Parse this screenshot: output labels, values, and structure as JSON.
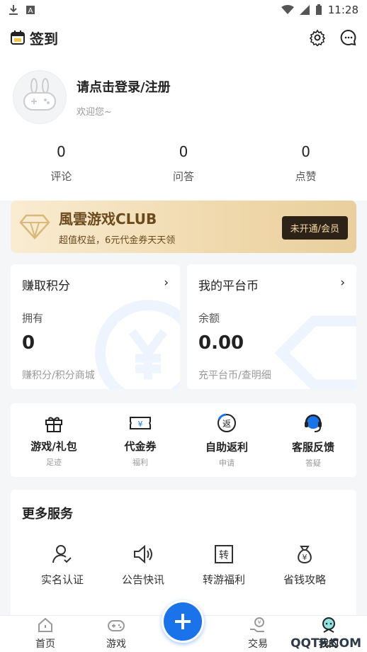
{
  "status_bar": {
    "time": "11:28"
  },
  "header": {
    "title": "签到"
  },
  "profile": {
    "login_prompt": "请点击登录/注册",
    "welcome": "欢迎您~"
  },
  "stats": [
    {
      "value": "0",
      "label": "评论"
    },
    {
      "value": "0",
      "label": "问答"
    },
    {
      "value": "0",
      "label": "点赞"
    }
  ],
  "club": {
    "name": "風雲游戏CLUB",
    "desc": "超值权益，6元代金券天天领",
    "button": "未开通/会员"
  },
  "cards": {
    "points": {
      "title": "赚取积分",
      "sub": "拥有",
      "value": "0",
      "foot": "赚积分/积分商城"
    },
    "coins": {
      "title": "我的平台币",
      "sub": "余额",
      "value": "0.00",
      "foot": "充平台币/查明细"
    }
  },
  "shortcuts": [
    {
      "label": "游戏/礼包",
      "sub": "足迹",
      "icon": "gift-icon"
    },
    {
      "label": "代金券",
      "sub": "福利",
      "icon": "coupon-icon"
    },
    {
      "label": "自助返利",
      "sub": "申请",
      "icon": "rebate-icon"
    },
    {
      "label": "客服反馈",
      "sub": "答疑",
      "icon": "headset-icon"
    }
  ],
  "services": {
    "title": "更多服务",
    "items": [
      {
        "label": "实名认证",
        "icon": "user-check-icon"
      },
      {
        "label": "公告快讯",
        "icon": "speaker-icon"
      },
      {
        "label": "转游福利",
        "icon": "transfer-icon"
      },
      {
        "label": "省钱攻略",
        "icon": "money-bag-icon"
      }
    ]
  },
  "bottom_nav": [
    {
      "label": "首页"
    },
    {
      "label": "游戏"
    },
    {
      "label": "交易"
    },
    {
      "label": "我的"
    }
  ],
  "watermark": "QQTF.COM",
  "colors": {
    "accent": "#1a73e8",
    "club_dark": "#2d2218",
    "club_text": "#6b4a1e"
  }
}
